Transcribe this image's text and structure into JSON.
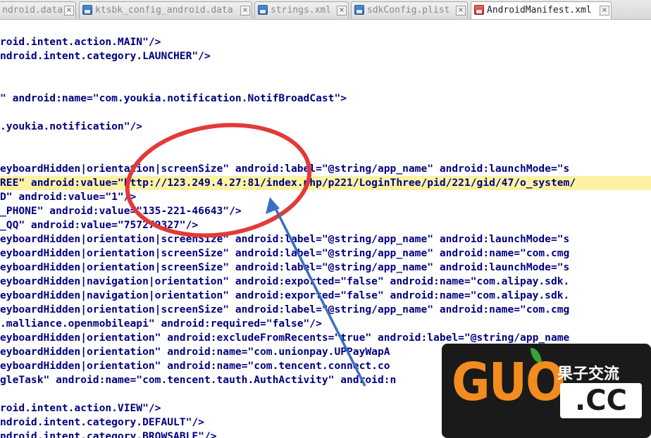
{
  "tabs": [
    {
      "label": "ndroid.data",
      "active": false,
      "icon": "file-icon"
    },
    {
      "label": "ktsbk_config_android.data",
      "active": false,
      "icon": "file-icon"
    },
    {
      "label": "strings.xml",
      "active": false,
      "icon": "file-icon"
    },
    {
      "label": "sdkConfig.plist",
      "active": false,
      "icon": "file-icon"
    },
    {
      "label": "AndroidManifest.xml",
      "active": true,
      "icon": "file-icon"
    }
  ],
  "code_lines": [
    "roid.intent.action.MAIN\"/>",
    "ndroid.intent.category.LAUNCHER\"/>",
    "",
    "",
    "\" android:name=\"com.youkia.notification.NotifBroadCast\">",
    "",
    ".youkia.notification\"/>",
    "",
    "",
    "eyboardHidden|orientation|screenSize\" android:label=\"@string/app_name\" android:launchMode=\"s",
    "REE\" android:value=\"http://123.249.4.27:81/index.php/p221/LoginThree/pid/221/gid/47/o_system/",
    "D\" android:value=\"1\"/>",
    "_PHONE\" android:value=\"135-221-46643\"/>",
    "_QQ\" android:value=\"757279327\"/>",
    "eyboardHidden|orientation|screenSize\" android:label=\"@string/app_name\" android:launchMode=\"s",
    "eyboardHidden|orientation|screenSize\" android:label=\"@string/app_name\" android:name=\"com.cmg",
    "eyboardHidden|orientation|screenSize\" android:label=\"@string/app_name\" android:launchMode=\"s",
    "eyboardHidden|navigation|orientation\" android:exported=\"false\" android:name=\"com.alipay.sdk.",
    "eyboardHidden|navigation|orientation\" android:exported=\"false\" android:name=\"com.alipay.sdk.",
    "eyboardHidden|orientation|screenSize\" android:label=\"@string/app_name\" android:name=\"com.cmg",
    ".malliance.openmobileapi\" android:required=\"false\"/>",
    "eyboardHidden|orientation\" android:excludeFromRecents=\"true\" android:label=\"@string/app_name",
    "eyboardHidden|orientation\" android:name=\"com.unionpay.UPPayWapA",
    "eyboardHidden|orientation\" android:name=\"com.tencent.connect.co",
    "gleTask\" android:name=\"com.tencent.tauth.AuthActivity\" android:n",
    "",
    "roid.intent.action.VIEW\"/>",
    "ndroid.intent.category.DEFAULT\"/>",
    "ndroid.intent.category.BROWSABLE\"/>"
  ],
  "highlighted_line_index": 10,
  "watermark": {
    "brand": "GUO",
    "chinese": "果子交流",
    "domain": ".CC"
  },
  "colors": {
    "code_text": "#000080",
    "highlight": "#fbf3a2",
    "annotation_circle": "#e23a3a",
    "annotation_arrow": "#3a6fc4",
    "logo_orange": "#f28c1f"
  }
}
